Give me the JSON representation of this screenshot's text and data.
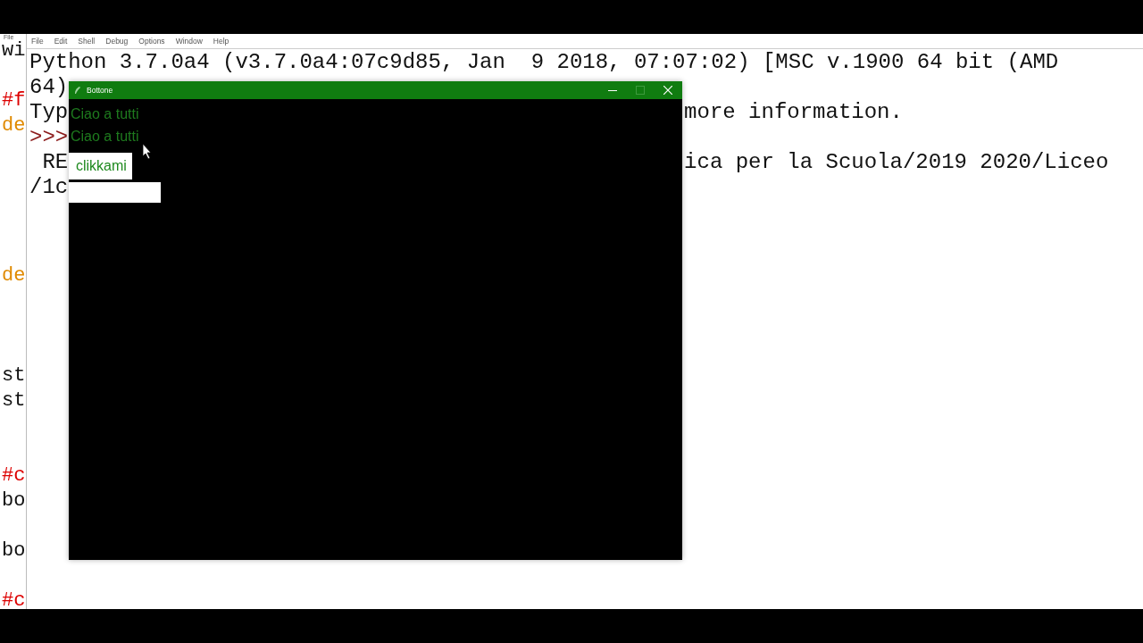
{
  "editor": {
    "menu": [
      "File"
    ],
    "lines": [
      {
        "kind": "plain",
        "text": "wi"
      },
      {
        "kind": "blank"
      },
      {
        "kind": "comment",
        "text": "#f"
      },
      {
        "kind": "keyword",
        "text": "de"
      },
      {
        "kind": "blank"
      },
      {
        "kind": "blank"
      },
      {
        "kind": "blank"
      },
      {
        "kind": "blank"
      },
      {
        "kind": "blank"
      },
      {
        "kind": "keyword",
        "text": "de"
      },
      {
        "kind": "blank"
      },
      {
        "kind": "blank"
      },
      {
        "kind": "blank"
      },
      {
        "kind": "plain",
        "text": "st"
      },
      {
        "kind": "plain",
        "text": "st"
      },
      {
        "kind": "blank"
      },
      {
        "kind": "blank"
      },
      {
        "kind": "comment",
        "text": "#c"
      },
      {
        "kind": "plain",
        "text": "bo"
      },
      {
        "kind": "blank"
      },
      {
        "kind": "plain",
        "text": "bo"
      },
      {
        "kind": "blank"
      },
      {
        "kind": "comment",
        "text": "#c"
      }
    ]
  },
  "shell": {
    "menu": [
      "File",
      "Edit",
      "Shell",
      "Debug",
      "Options",
      "Window",
      "Help"
    ],
    "lines": [
      {
        "left": "Python 3.7.0a4 (v3.7.0a4:07c9d85, Jan  9 2018, 07:07:02) [MSC v.1900 64 bit (AMD"
      },
      {
        "left": "64)"
      },
      {
        "left": "Typ",
        "right": "more information."
      },
      {
        "left": ">>>",
        "kind": "prompt"
      },
      {
        "left": " RE",
        "right": "ica per la Scuola/2019 2020/Liceo"
      },
      {
        "left": "/1c"
      }
    ]
  },
  "tk_window": {
    "title": "Bottone",
    "labels": [
      "Ciao a tutti",
      "Ciao a tutti"
    ],
    "button": "clikkami"
  }
}
